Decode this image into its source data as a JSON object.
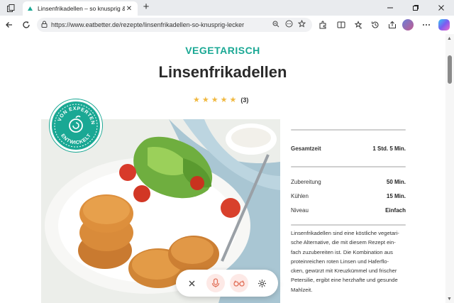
{
  "browser": {
    "tab_title": "Linsenfrikadellen – so knusprig &",
    "url": "https://www.eatbetter.de/rezepte/linsenfrikadellen-so-knusprig-lecker",
    "new_tab_label": "+",
    "tab_close": "✕"
  },
  "page": {
    "category": "VEGETARISCH",
    "title": "Linsenfrikadellen",
    "rating_count": "(3)",
    "rating_stars": 5,
    "badge_text": "VON EXPERTEN ENTWICKELT"
  },
  "info": {
    "total": {
      "label": "Gesamtzeit",
      "value": "1 Std. 5 Min."
    },
    "rows": [
      {
        "label": "Zubereitung",
        "value": "50 Min."
      },
      {
        "label": "Kühlen",
        "value": "15 Min."
      },
      {
        "label": "Niveau",
        "value": "Einfach"
      }
    ]
  },
  "description": [
    "Linsenfrikadellen sind eine köstliche vegetari-",
    "sche Alternative, die mit diesem Rezept ein-",
    "fach zuzubereiten ist. Die Kombination aus",
    "proteinreichen roten Linsen und Haferflo-",
    "cken, gewürzt mit Kreuzkümmel und frischer",
    "Petersilie, ergibt eine herzhafte und gesunde",
    "Mahlzeit."
  ],
  "colors": {
    "brand": "#1aa894",
    "star": "#f0b840",
    "accent": "#e2725b"
  },
  "icons": [
    "back-icon",
    "reload-icon",
    "lock-icon",
    "zoom-icon",
    "more-icon",
    "favorite-icon",
    "extensions-icon",
    "split-screen-icon",
    "collections-icon",
    "history-icon",
    "share-icon",
    "settings-more-icon",
    "close-icon",
    "microphone-icon",
    "glasses-icon",
    "gear-icon"
  ]
}
